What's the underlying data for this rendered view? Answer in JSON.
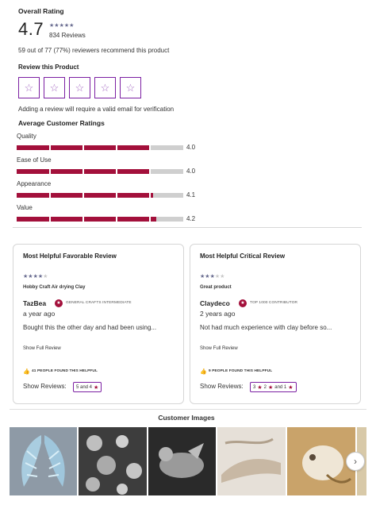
{
  "summary": {
    "overall_title": "Overall Rating",
    "rating_value": "4.7",
    "rating_stars": 4.7,
    "review_count": "834 Reviews",
    "recommend_text": "59 out of 77 (77%) reviewers recommend this product"
  },
  "review_product": {
    "title": "Review this Product",
    "star_count": 5,
    "note": "Adding a review will require a valid email for verification"
  },
  "averages": {
    "title": "Average Customer Ratings",
    "items": [
      {
        "label": "Quality",
        "value": "4.0"
      },
      {
        "label": "Ease of Use",
        "value": "4.0"
      },
      {
        "label": "Appearance",
        "value": "4.1"
      },
      {
        "label": "Value",
        "value": "4.2"
      }
    ]
  },
  "favorable": {
    "title": "Most Helpful Favorable Review",
    "stars": 4,
    "headline": "Hobby Craft Air drying Clay",
    "author": "TazBea",
    "badge": "GENERAL CRAFTS INTERMEDIATE",
    "time": "a year ago",
    "body": "Bought this the other day and had been using...",
    "show_full": "Show Full Review",
    "helpful": "41 PEOPLE FOUND THIS HELPFUL",
    "show_reviews_label": "Show Reviews:",
    "chips": [
      {
        "text": "5 and 4"
      }
    ]
  },
  "critical": {
    "title": "Most Helpful Critical Review",
    "stars": 3,
    "headline": "Great product",
    "author": "Claydeco",
    "badge": "TOP 1000 CONTRIBUTOR",
    "time": "2 years ago",
    "body": "Not had much experience with clay before so...",
    "show_full": "Show Full Review",
    "helpful": "9 PEOPLE FOUND THIS HELPFUL",
    "show_reviews_label": "Show Reviews:",
    "chips": [
      {
        "a": "3",
        "b": "2",
        "c": "and 1"
      }
    ]
  },
  "customer_images": {
    "title": "Customer Images",
    "next_label": "›"
  },
  "colors": {
    "accent": "#a3103b",
    "star": "#6a6d91",
    "border_accent": "#7b1fa2"
  }
}
